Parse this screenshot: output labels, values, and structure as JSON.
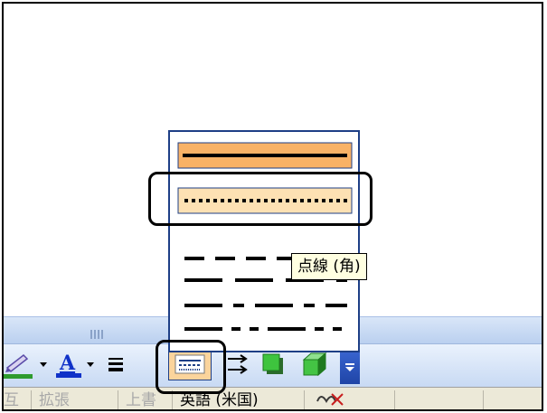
{
  "dash_style_menu": {
    "items": [
      {
        "style": "solid",
        "selected": true
      },
      {
        "style": "round-dot",
        "hovered": true
      },
      {
        "style": "dash"
      },
      {
        "style": "long-dash"
      },
      {
        "style": "long-dash-dot"
      },
      {
        "style": "long-dash-dot-dot"
      }
    ],
    "tooltip": "点線 (角)"
  },
  "drawing_toolbar": {
    "tools": [
      "line-color-icon",
      "font-color-icon",
      "line-style-icon",
      "dash-style-icon",
      "arrow-style-icon",
      "shadow-style-icon",
      "3d-style-icon",
      "toolbar-options-icon"
    ],
    "accent_colors": {
      "selection": "#f9b266",
      "selection_light": "#fde1b3",
      "border": "#1e3f86",
      "line_green": "#2e9b2e",
      "font_blue": "#1032c8",
      "font_red": "#c81e1e"
    }
  },
  "status_bar": {
    "cells": [
      "互",
      "拡張",
      "上書",
      "英語 (米国)",
      ""
    ]
  }
}
